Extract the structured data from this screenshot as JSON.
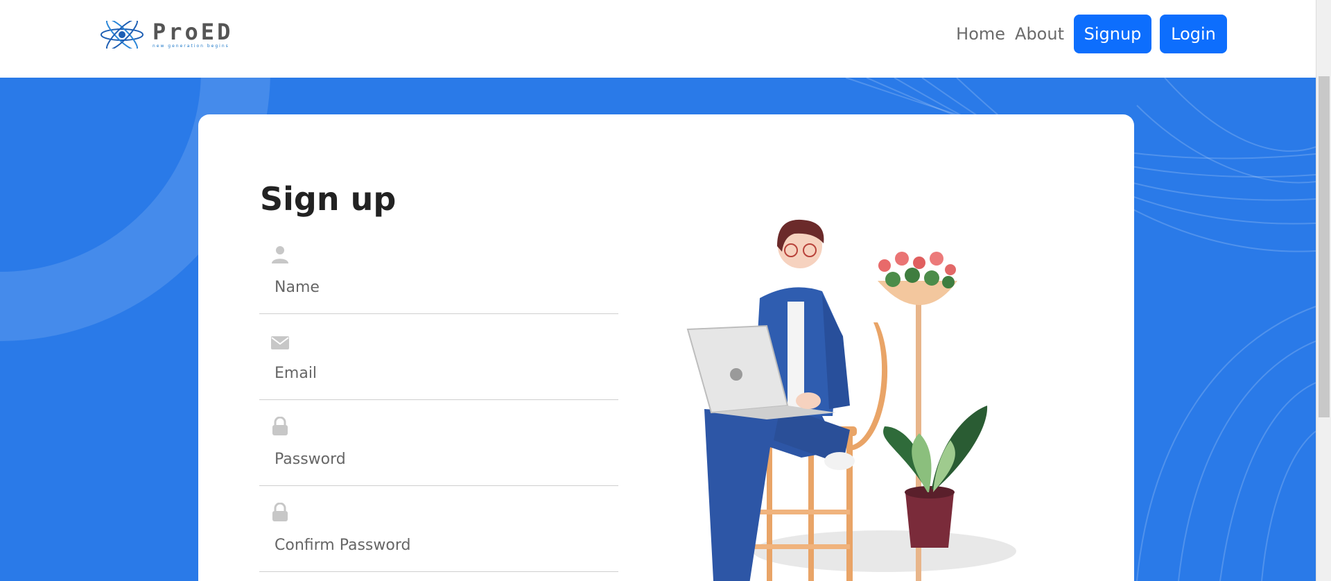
{
  "brand": {
    "name": "ProED",
    "tagline": "new generation begins"
  },
  "nav": {
    "home": "Home",
    "about": "About",
    "signup": "Signup",
    "login": "Login"
  },
  "form": {
    "title": "Sign up",
    "fields": [
      {
        "icon": "user-icon",
        "placeholder": "Name"
      },
      {
        "icon": "envelope-icon",
        "placeholder": "Email"
      },
      {
        "icon": "lock-icon",
        "placeholder": "Password"
      },
      {
        "icon": "lock-icon",
        "placeholder": "Confirm Password"
      }
    ]
  },
  "colors": {
    "primary": "#0d6efd",
    "hero": "#2a7ae8"
  },
  "illustration": "person-with-laptop-illustration"
}
